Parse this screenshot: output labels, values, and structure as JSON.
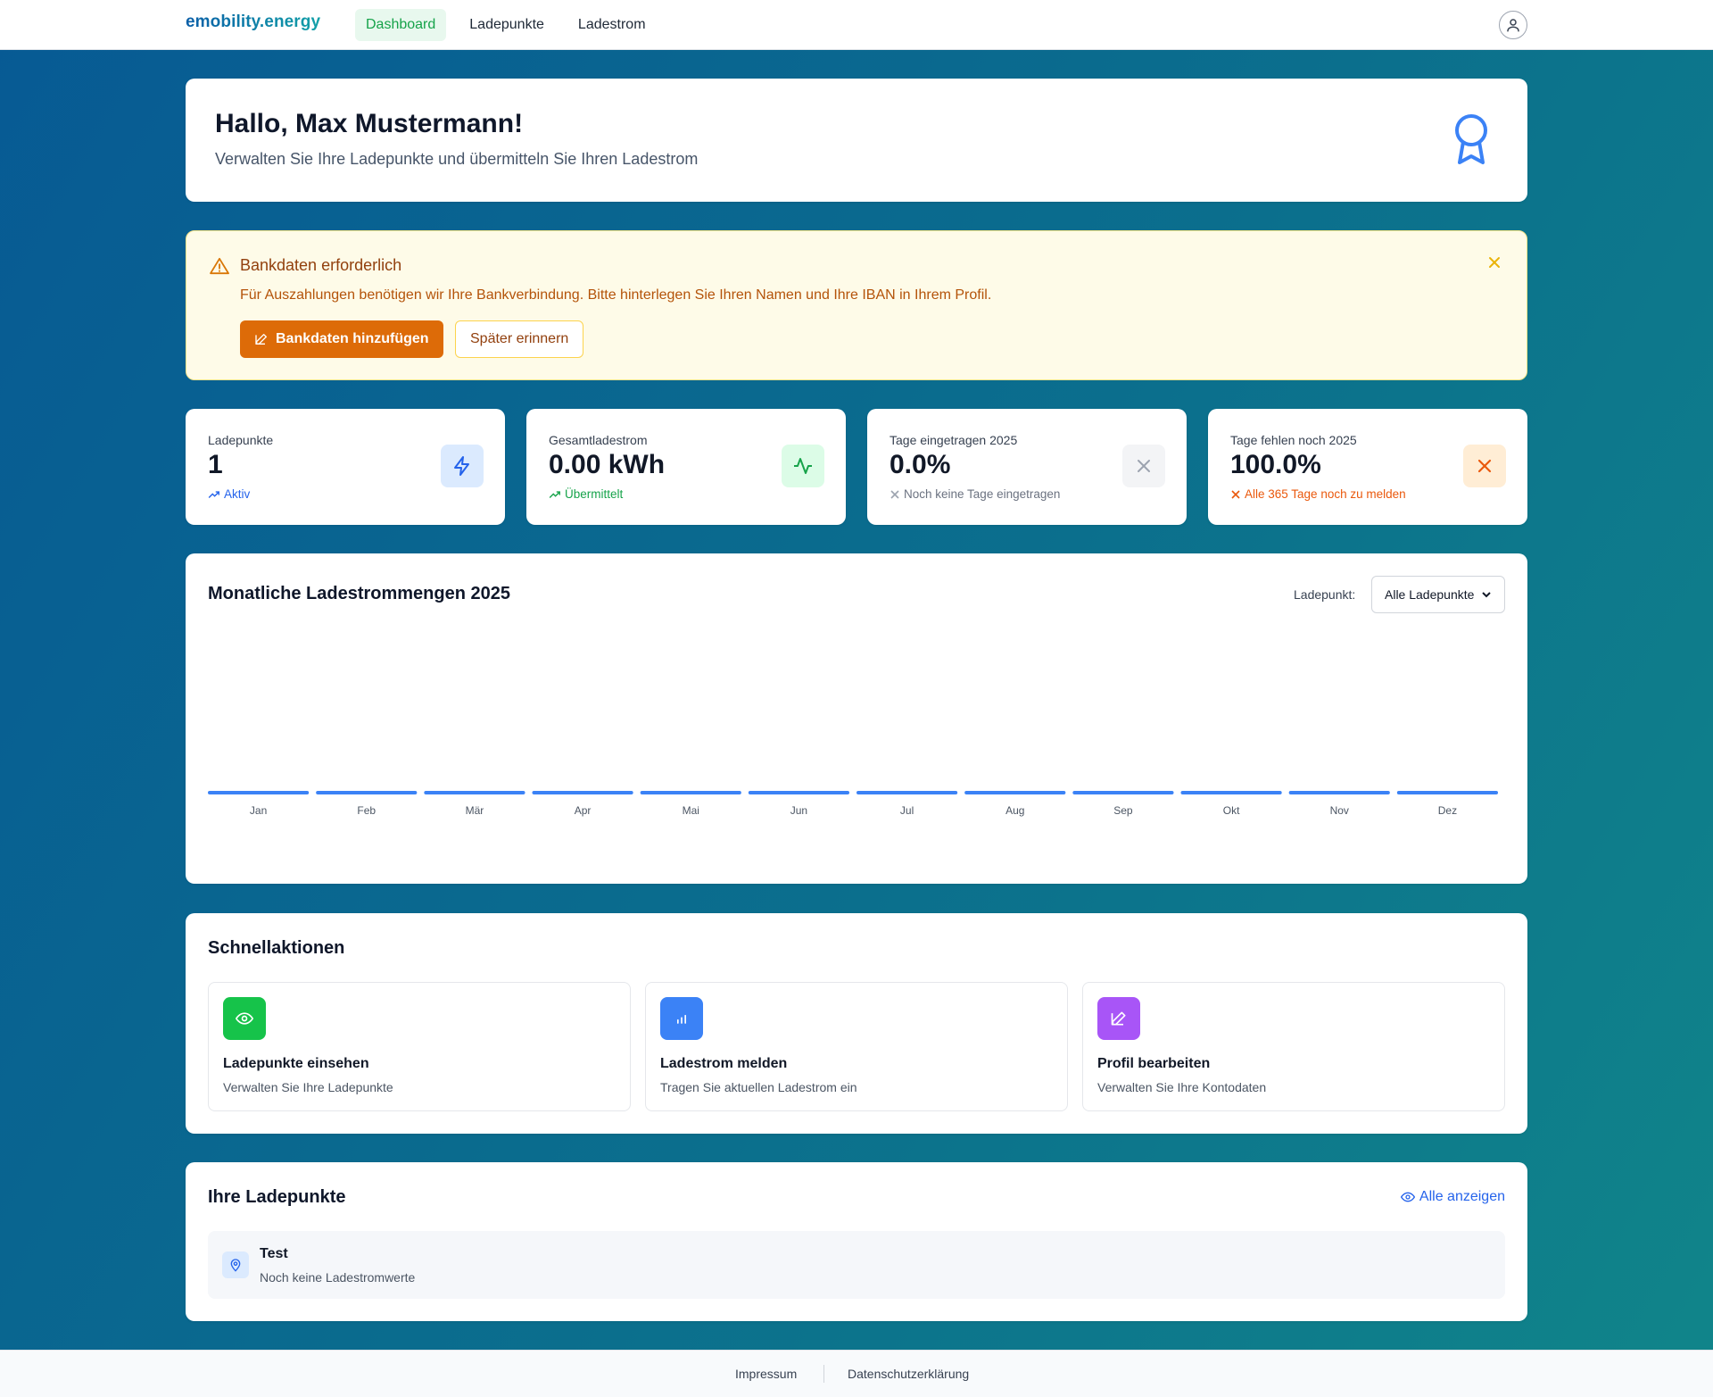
{
  "nav": {
    "logo": "emobility.energy",
    "items": [
      {
        "label": "Dashboard",
        "active": true
      },
      {
        "label": "Ladepunkte",
        "active": false
      },
      {
        "label": "Ladestrom",
        "active": false
      }
    ],
    "user_icon": "user-icon"
  },
  "welcome": {
    "title": "Hallo, Max Mustermann!",
    "subtitle": "Verwalten Sie Ihre Ladepunkte und übermitteln Sie Ihren Ladestrom",
    "icon": "award-icon"
  },
  "alert": {
    "title": "Bankdaten erforderlich",
    "text": "Für Auszahlungen benötigen wir Ihre Bankverbindung. Bitte hinterlegen Sie Ihren Namen und Ihre IBAN in Ihrem Profil.",
    "primary_label": "Bankdaten hinzufügen",
    "secondary_label": "Später erinnern",
    "colors": {
      "primary": "#dd6b08",
      "background": "#fefbe8"
    }
  },
  "stats": [
    {
      "label": "Ladepunkte",
      "value": "1",
      "sub": "Aktiv",
      "sub_color": "#2563eb",
      "icon": "zap-icon"
    },
    {
      "label": "Gesamtladestrom",
      "value": "0.00 kWh",
      "sub": "Übermittelt",
      "sub_color": "#16a34a",
      "icon": "activity-icon"
    },
    {
      "label": "Tage eingetragen 2025",
      "value": "0.0%",
      "sub": "Noch keine Tage eingetragen",
      "sub_color": "#6b7280",
      "icon": "x-icon"
    },
    {
      "label": "Tage fehlen noch 2025",
      "value": "100.0%",
      "sub": "Alle 365 Tage noch zu melden",
      "sub_color": "#ea580c",
      "icon": "x-icon"
    }
  ],
  "chart": {
    "filter_label": "Ladepunkt:",
    "filter_value": "Alle Ladepunkte"
  },
  "chart_data": {
    "type": "bar",
    "title": "Monatliche Ladestrommengen 2025",
    "categories": [
      "Jan",
      "Feb",
      "Mär",
      "Apr",
      "Mai",
      "Jun",
      "Jul",
      "Aug",
      "Sep",
      "Okt",
      "Nov",
      "Dez"
    ],
    "values": [
      0,
      0,
      0,
      0,
      0,
      0,
      0,
      0,
      0,
      0,
      0,
      0
    ],
    "xlabel": "",
    "ylabel": "",
    "color": "#3b82f6"
  },
  "quick_actions": {
    "title": "Schnellaktionen",
    "items": [
      {
        "title": "Ladepunkte einsehen",
        "desc": "Verwalten Sie Ihre Ladepunkte",
        "icon": "eye-icon",
        "color": "#16c34a"
      },
      {
        "title": "Ladestrom melden",
        "desc": "Tragen Sie aktuellen Ladestrom ein",
        "icon": "bar-chart-icon",
        "color": "#3b82f6"
      },
      {
        "title": "Profil bearbeiten",
        "desc": "Verwalten Sie Ihre Kontodaten",
        "icon": "edit-icon",
        "color": "#a855f7"
      }
    ]
  },
  "ladepunkte": {
    "title": "Ihre Ladepunkte",
    "show_all": "Alle anzeigen",
    "items": [
      {
        "name": "Test",
        "status": "Noch keine Ladestromwerte",
        "icon": "map-pin-icon"
      }
    ]
  },
  "footer": {
    "links": [
      "Impressum",
      "Datenschutzerklärung"
    ]
  }
}
